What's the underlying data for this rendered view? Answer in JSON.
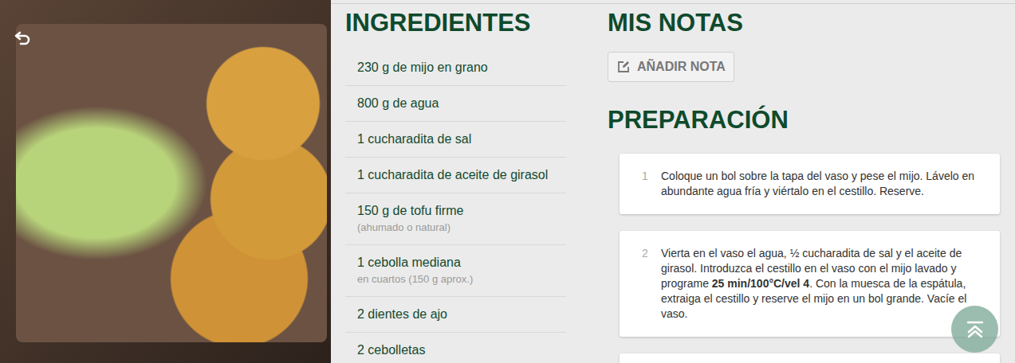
{
  "ingredients": {
    "title": "INGREDIENTES",
    "items": [
      {
        "name": "230 g de mijo en grano",
        "note": ""
      },
      {
        "name": "800 g de agua",
        "note": ""
      },
      {
        "name": "1 cucharadita de sal",
        "note": ""
      },
      {
        "name": "1 cucharadita de aceite de girasol",
        "note": ""
      },
      {
        "name": "150 g de tofu firme",
        "note": "(ahumado o natural)"
      },
      {
        "name": "1 cebolla mediana",
        "note": "en cuartos (150 g aprox.)"
      },
      {
        "name": "2 dientes de ajo",
        "note": ""
      },
      {
        "name": "2 cebolletas",
        "note": ""
      }
    ]
  },
  "notes": {
    "title": "MIS NOTAS",
    "button": "AÑADIR NOTA"
  },
  "preparation": {
    "title": "PREPARACIÓN",
    "steps": [
      {
        "number": "1",
        "segments": [
          {
            "text": "Coloque un bol sobre la tapa del vaso y pese el mijo. Lávelo en abundante agua fría y viértalo en el cestillo. Reserve.",
            "bold": false
          }
        ]
      },
      {
        "number": "2",
        "segments": [
          {
            "text": "Vierta en el vaso el agua, ½ cucharadita de sal y el aceite de girasol. Introduzca el cestillo en el vaso con el mijo lavado y programe ",
            "bold": false
          },
          {
            "text": "25 min/100°C/vel 4",
            "bold": true
          },
          {
            "text": ". Con la muesca de la espátula, extraiga el cestillo y reserve el mijo en un bol grande. Vacíe el vaso.",
            "bold": false
          }
        ]
      },
      {
        "number": "",
        "segments": []
      }
    ]
  }
}
